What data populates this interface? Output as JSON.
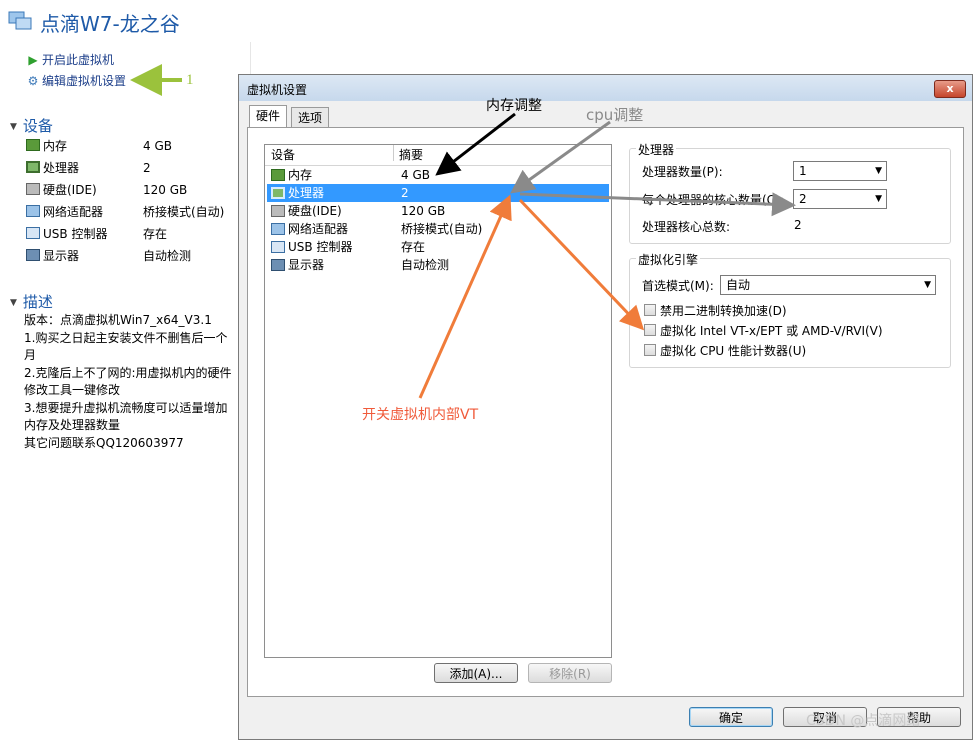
{
  "app": {
    "title": "点滴W7-龙之谷",
    "actions": [
      {
        "label": "开启此虚拟机",
        "icon": "play-icon"
      },
      {
        "label": "编辑虚拟机设置",
        "icon": "edit-settings-icon"
      }
    ],
    "annotation_1": "1",
    "devices_section": "设备",
    "devices": [
      {
        "name": "内存",
        "value": "4 GB",
        "icon": "memory-icon"
      },
      {
        "name": "处理器",
        "value": "2",
        "icon": "cpu-icon"
      },
      {
        "name": "硬盘(IDE)",
        "value": "120 GB",
        "icon": "disk-icon"
      },
      {
        "name": "网络适配器",
        "value": "桥接模式(自动)",
        "icon": "network-icon"
      },
      {
        "name": "USB 控制器",
        "value": "存在",
        "icon": "usb-icon"
      },
      {
        "name": "显示器",
        "value": "自动检测",
        "icon": "monitor-icon"
      }
    ],
    "desc_section": "描述",
    "desc_text": "版本：点滴虚拟机Win7_x64_V3.1\n1.购买之日起主安装文件不删售后一个月\n2.克隆后上不了网的:用虚拟机内的硬件修改工具一键修改\n3.想要提升虚拟机流畅度可以适量增加内存及处理器数量\n其它问题联系QQ120603977"
  },
  "dialog": {
    "title": "虚拟机设置",
    "close": "x",
    "tabs": [
      "硬件",
      "选项"
    ],
    "list_headers": [
      "设备",
      "摘要"
    ],
    "rows": [
      {
        "name": "内存",
        "value": "4 GB",
        "icon": "memory-icon"
      },
      {
        "name": "处理器",
        "value": "2",
        "icon": "cpu-icon"
      },
      {
        "name": "硬盘(IDE)",
        "value": "120 GB",
        "icon": "disk-icon"
      },
      {
        "name": "网络适配器",
        "value": "桥接模式(自动)",
        "icon": "network-icon"
      },
      {
        "name": "USB 控制器",
        "value": "存在",
        "icon": "usb-icon"
      },
      {
        "name": "显示器",
        "value": "自动检测",
        "icon": "monitor-icon"
      }
    ],
    "selected_row": 1,
    "add_button": "添加(A)...",
    "remove_button": "移除(R)",
    "processor_group": "处理器",
    "proc_count_label": "处理器数量(P):",
    "proc_count_value": "1",
    "cores_label": "每个处理器的核心数量(C):",
    "cores_value": "2",
    "total_label": "处理器核心总数:",
    "total_value": "2",
    "virt_group": "虚拟化引擎",
    "mode_label": "首选模式(M):",
    "mode_value": "自动",
    "checks": [
      {
        "label": "禁用二进制转换加速(D)",
        "checked": false
      },
      {
        "label": "虚拟化 Intel VT-x/EPT 或 AMD-V/RVI(V)",
        "checked": false
      },
      {
        "label": "虚拟化 CPU 性能计数器(U)",
        "checked": false
      }
    ],
    "ok_button": "确定",
    "cancel_button": "取消",
    "help_button": "帮助"
  },
  "annotations": {
    "memory": "内存调整",
    "cpu": "cpu调整",
    "vt": "开关虚拟机内部VT",
    "watermark": "CSDN @点滴网络"
  },
  "colors": {
    "title_blue": "#1e5aa8",
    "selection": "#3399ff",
    "arrow_orange": "#f07c3a",
    "arrow_gray": "#8a8a8a",
    "arrow_green": "#9bc23c",
    "vt_text": "#f05a3a"
  }
}
